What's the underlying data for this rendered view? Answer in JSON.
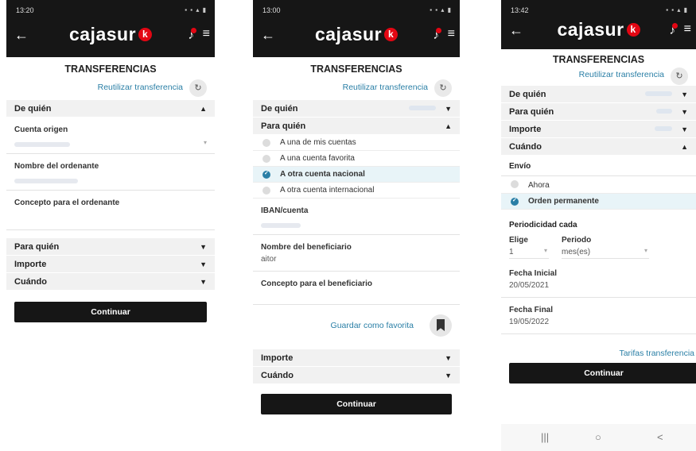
{
  "common": {
    "logo": "cajasur",
    "logo_badge": "k",
    "title": "TRANSFERENCIAS",
    "reuse": "Reutilizar transferencia",
    "continue": "Continuar"
  },
  "screen1": {
    "time": "13:20",
    "sections": {
      "from": "De quién",
      "to": "Para quién",
      "amount": "Importe",
      "when": "Cuándo"
    },
    "fields": {
      "origin_account": "Cuenta origen",
      "orderer_name": "Nombre del ordenante",
      "orderer_concept": "Concepto para el ordenante"
    }
  },
  "screen2": {
    "time": "13:00",
    "sections": {
      "from": "De quién",
      "to": "Para quién",
      "amount": "Importe",
      "when": "Cuándo"
    },
    "options": [
      "A una de mis cuentas",
      "A una cuenta favorita",
      "A otra cuenta nacional",
      "A otra cuenta internacional"
    ],
    "fields": {
      "iban": "IBAN/cuenta",
      "beneficiary_name": "Nombre del beneficiario",
      "beneficiary_name_value": "aitor",
      "beneficiary_concept": "Concepto para el beneficiario"
    },
    "save_favorite": "Guardar como favorita"
  },
  "screen3": {
    "time": "13:42",
    "sections": {
      "from": "De quién",
      "to": "Para quién",
      "amount": "Importe",
      "when": "Cuándo"
    },
    "envio_label": "Envío",
    "envio_options": [
      "Ahora",
      "Orden permanente"
    ],
    "periodicity_label": "Periodicidad cada",
    "choose_label": "Elige",
    "choose_value": "1",
    "period_label": "Periodo",
    "period_value": "mes(es)",
    "start_label": "Fecha Inicial",
    "start_value": "20/05/2021",
    "end_label": "Fecha Final",
    "end_value": "19/05/2022",
    "fees_link": "Tarifas transferencia"
  },
  "icons": {
    "back": "←",
    "bell": "🔔",
    "menu": "≡",
    "reuse": "↻",
    "up": "▲",
    "down": "▼",
    "dropdown": "▾",
    "nav_recent": "|||",
    "nav_home": "○",
    "nav_back": "<"
  }
}
